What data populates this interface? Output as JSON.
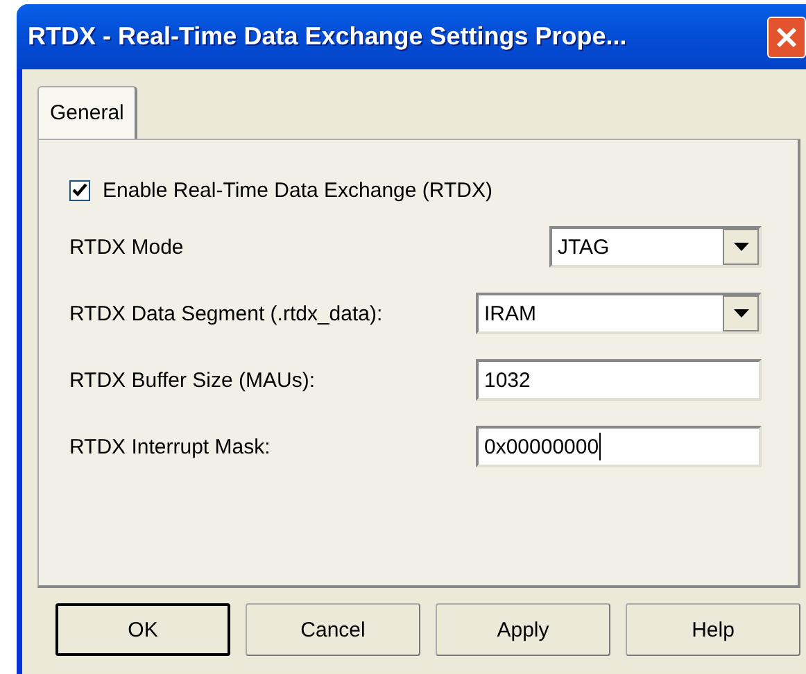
{
  "window": {
    "title": "RTDX - Real-Time Data Exchange Settings Prope..."
  },
  "tabs": [
    {
      "label": "General",
      "selected": true
    }
  ],
  "enable": {
    "label": "Enable Real-Time Data Exchange (RTDX)",
    "checked": true
  },
  "fields": [
    {
      "kind": "combo",
      "label": "RTDX Mode",
      "value": "JTAG",
      "narrow": true
    },
    {
      "kind": "combo",
      "label": "RTDX Data Segment (.rtdx_data):",
      "value": "IRAM",
      "narrow": false
    },
    {
      "kind": "text",
      "label": "RTDX Buffer Size (MAUs):",
      "value": "1032",
      "focused": false
    },
    {
      "kind": "text",
      "label": "RTDX Interrupt Mask:",
      "value": "0x00000000",
      "focused": true
    }
  ],
  "buttons": [
    {
      "label": "OK",
      "default": true
    },
    {
      "label": "Cancel",
      "default": false
    },
    {
      "label": "Apply",
      "default": false
    },
    {
      "label": "Help",
      "default": false
    }
  ]
}
